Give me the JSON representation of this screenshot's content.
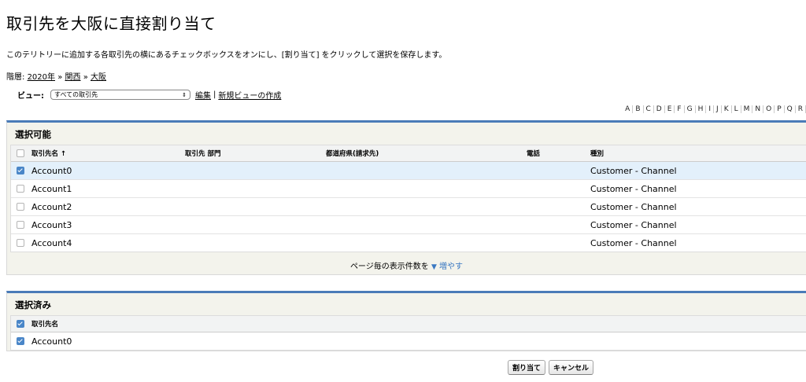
{
  "page": {
    "title": "取引先を大阪に直接割り当て",
    "instructions": "このテリトリーに追加する各取引先の横にあるチェックボックスをオンにし、[割り当て] をクリックして選択を保存します。"
  },
  "breadcrumb": {
    "label": "階層:",
    "items": [
      "2020年",
      "関西",
      "大阪"
    ],
    "separator": "»"
  },
  "view": {
    "label": "ビュー:",
    "selected": "すべての取引先",
    "edit_link": "編集",
    "divider": "|",
    "new_view_link": "新規ビューの作成"
  },
  "alpha_filter": [
    "A",
    "B",
    "C",
    "D",
    "E",
    "F",
    "G",
    "H",
    "I",
    "J",
    "K",
    "L",
    "M",
    "N",
    "O",
    "P",
    "Q",
    "R"
  ],
  "available": {
    "title": "選択可能",
    "columns": [
      "取引先名 ↑",
      "取引先 部門",
      "都道府県(請求先)",
      "電話",
      "種別"
    ],
    "rows": [
      {
        "name": "Account0",
        "division": "",
        "state": "",
        "phone": "",
        "type": "Customer - Channel",
        "checked": true
      },
      {
        "name": "Account1",
        "division": "",
        "state": "",
        "phone": "",
        "type": "Customer - Channel",
        "checked": false
      },
      {
        "name": "Account2",
        "division": "",
        "state": "",
        "phone": "",
        "type": "Customer - Channel",
        "checked": false
      },
      {
        "name": "Account3",
        "division": "",
        "state": "",
        "phone": "",
        "type": "Customer - Channel",
        "checked": false
      },
      {
        "name": "Account4",
        "division": "",
        "state": "",
        "phone": "",
        "type": "Customer - Channel",
        "checked": false
      }
    ],
    "pager_text": "ページ毎の表示件数を",
    "pager_link": "増やす"
  },
  "selected": {
    "title": "選択済み",
    "columns": [
      "取引先名"
    ],
    "rows": [
      {
        "name": "Account0",
        "checked": true
      }
    ]
  },
  "buttons": {
    "assign": "割り当て",
    "cancel": "キャンセル"
  },
  "colors": {
    "accent": "#4a7bb8",
    "check": "#4a86c8",
    "selected_row": "#e3f0fb",
    "link": "#3a78c2"
  }
}
